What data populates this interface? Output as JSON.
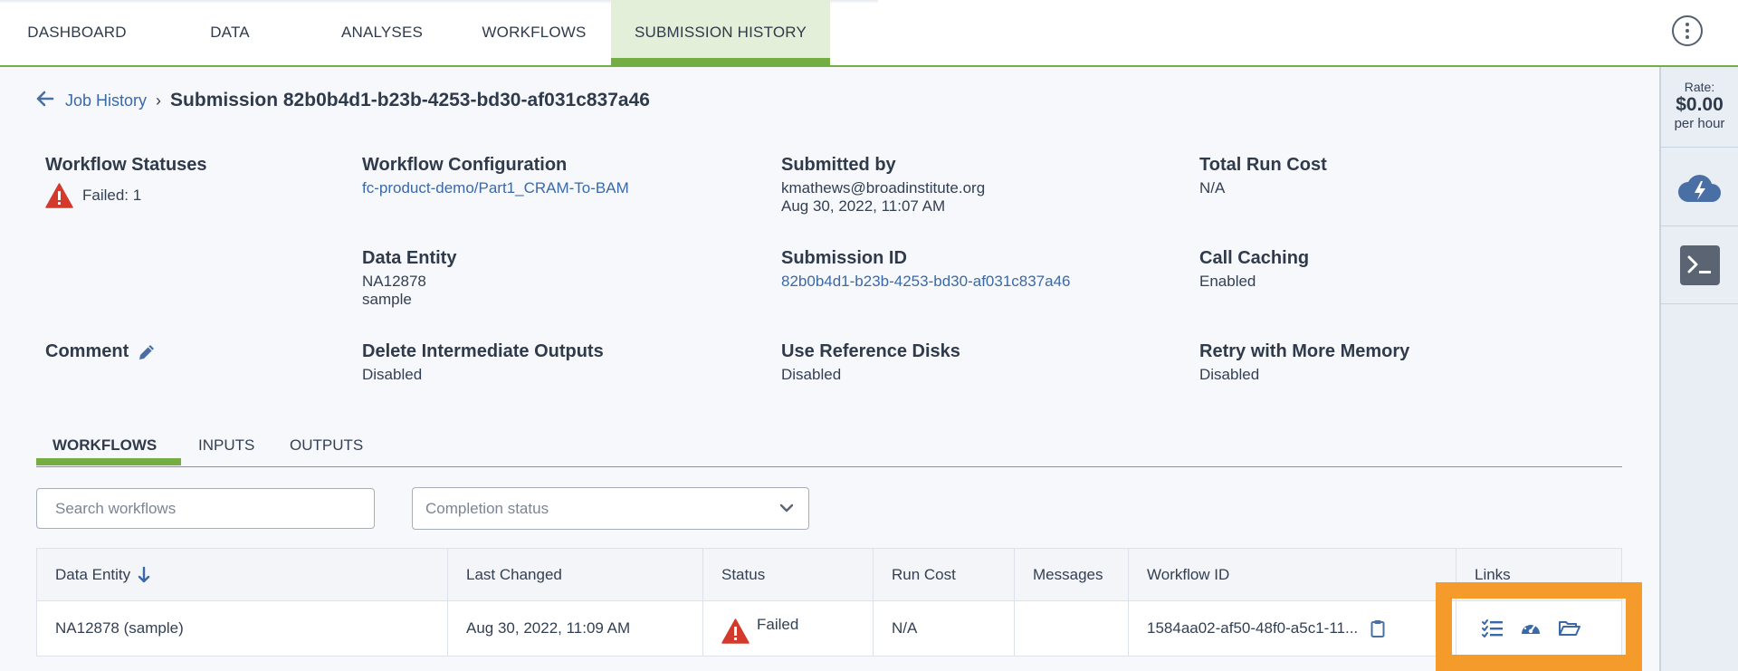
{
  "nav": {
    "tabs": [
      "DASHBOARD",
      "DATA",
      "ANALYSES",
      "WORKFLOWS",
      "SUBMISSION HISTORY"
    ],
    "active_tab": "SUBMISSION HISTORY"
  },
  "breadcrumb": {
    "back_link": "Job History",
    "separator": "›",
    "title": "Submission 82b0b4d1-b23b-4253-bd30-af031c837a46"
  },
  "summary": {
    "workflow_statuses": {
      "label": "Workflow Statuses",
      "failed": "Failed: 1"
    },
    "workflow_configuration": {
      "label": "Workflow Configuration",
      "value": "fc-product-demo/Part1_CRAM-To-BAM"
    },
    "submitted_by": {
      "label": "Submitted by",
      "email": "kmathews@broadinstitute.org",
      "date": "Aug 30, 2022, 11:07 AM"
    },
    "total_run_cost": {
      "label": "Total Run Cost",
      "value": "N/A"
    },
    "data_entity": {
      "label": "Data Entity",
      "name": "NA12878",
      "type": "sample"
    },
    "submission_id": {
      "label": "Submission ID",
      "value": "82b0b4d1-b23b-4253-bd30-af031c837a46"
    },
    "call_caching": {
      "label": "Call Caching",
      "value": "Enabled"
    },
    "comment": {
      "label": "Comment"
    },
    "delete_intermediate": {
      "label": "Delete Intermediate Outputs",
      "value": "Disabled"
    },
    "use_reference_disks": {
      "label": "Use Reference Disks",
      "value": "Disabled"
    },
    "retry_memory": {
      "label": "Retry with More Memory",
      "value": "Disabled"
    }
  },
  "subtabs": [
    "WORKFLOWS",
    "INPUTS",
    "OUTPUTS"
  ],
  "filters": {
    "search_placeholder": "Search workflows",
    "status_placeholder": "Completion status"
  },
  "table": {
    "headers": [
      "Data Entity",
      "Last Changed",
      "Status",
      "Run Cost",
      "Messages",
      "Workflow ID",
      "Links"
    ],
    "rows": [
      {
        "data_entity": "NA12878 (sample)",
        "last_changed": "Aug 30, 2022, 11:09 AM",
        "status": "Failed",
        "run_cost": "N/A",
        "messages": "",
        "workflow_id": "1584aa02-af50-48f0-a5c1-11..."
      }
    ]
  },
  "rail": {
    "rate_label": "Rate:",
    "rate_value": "$0.00",
    "rate_unit": "per hour"
  },
  "colors": {
    "accent_green": "#74ae43",
    "link_blue": "#3b69a8",
    "error_red": "#d33a2c",
    "highlight_orange": "#f49b2c"
  }
}
